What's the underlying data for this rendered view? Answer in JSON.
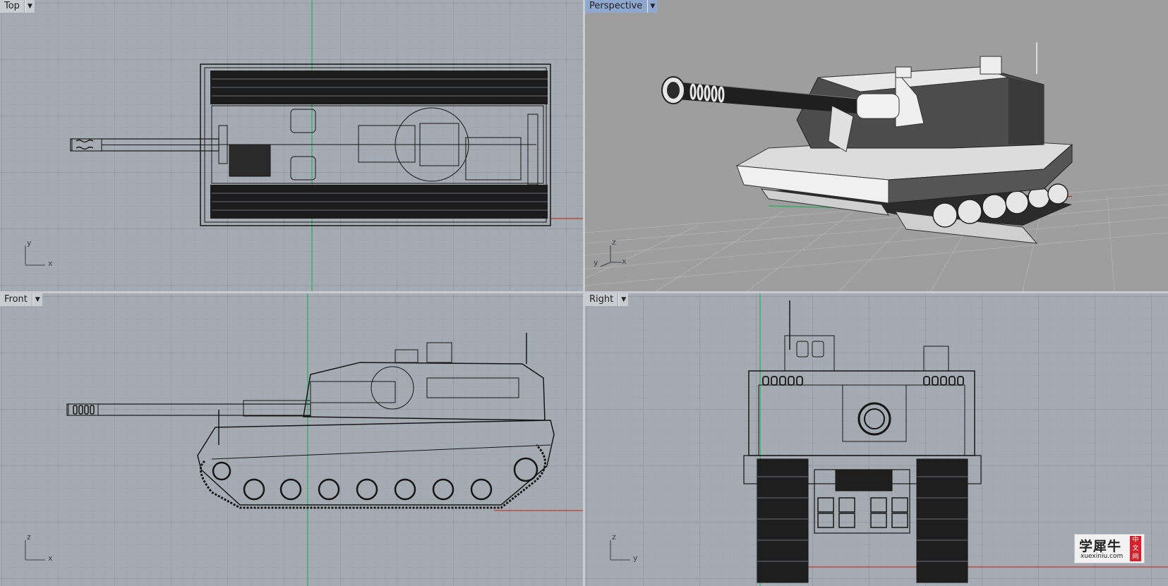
{
  "viewports": {
    "top": {
      "title": "Top",
      "axes": {
        "v": "y",
        "h": "x"
      }
    },
    "perspective": {
      "title": "Perspective",
      "axes": {
        "v": "z",
        "h1": "y",
        "h2": "x"
      }
    },
    "front": {
      "title": "Front",
      "axes": {
        "v": "z",
        "h": "x"
      }
    },
    "right": {
      "title": "Right",
      "axes": {
        "v": "z",
        "h": "y"
      }
    }
  },
  "watermark": {
    "chinese": "学犀牛",
    "site": "xuexiniu.com",
    "badge": [
      "中",
      "文",
      "网"
    ]
  },
  "colors": {
    "viewport_bg": "#a5abb3",
    "persp_bg": "#9e9e9e",
    "grid_minor": "#9aa0a8",
    "grid_major": "#8a9099",
    "x_axis": "#c0392b",
    "y_axis": "#27ae60",
    "wire": "#161616",
    "active_tab": "#8fa8cf"
  },
  "icons": {
    "dropdown": "chevron-down-icon"
  }
}
